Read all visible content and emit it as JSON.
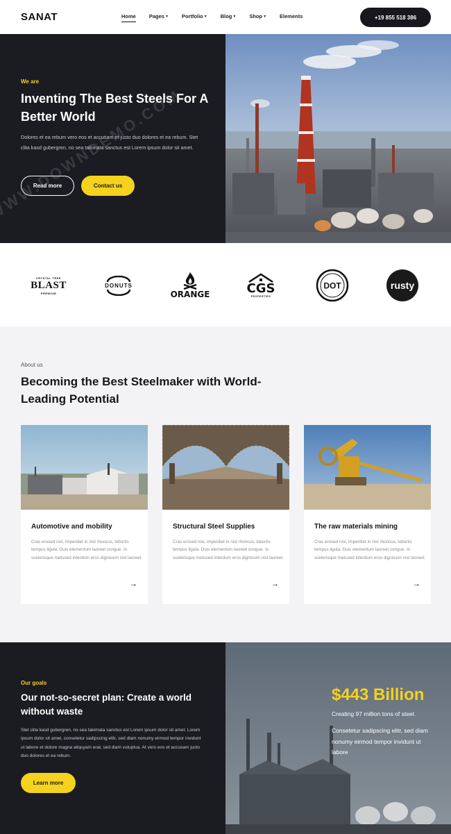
{
  "header": {
    "logo": "SANAT",
    "nav": [
      {
        "label": "Home",
        "has_caret": false,
        "active": true
      },
      {
        "label": "Pages",
        "has_caret": true
      },
      {
        "label": "Portfolio",
        "has_caret": true
      },
      {
        "label": "Blog",
        "has_caret": true
      },
      {
        "label": "Shop",
        "has_caret": true
      },
      {
        "label": "Elements",
        "has_caret": false
      }
    ],
    "phone": "+19 855 518 386"
  },
  "hero": {
    "kicker": "We are",
    "title": "Inventing The Best Steels For A Better World",
    "text": "Dolores et ea rebum vero eos et accusam et justo duo dolores et ea rebum. Stet clita kasd gubergren, no sea takimata sanctus est Lorem ipsum dolor sit amet.",
    "btn_read_more": "Read more",
    "btn_contact": "Contact us"
  },
  "brands": {
    "blast": {
      "top": "CRYSTAL TREE",
      "name": "BLAST",
      "bottom": "PREMIUM"
    },
    "donuts": {
      "name": "DONUTS"
    },
    "orange": {
      "name": "ORANGE"
    },
    "cgs": {
      "name": "CGS",
      "bottom": "PROPERTIES"
    },
    "dot": {
      "name": "DOT"
    },
    "rusty": {
      "name": "rusty"
    }
  },
  "about": {
    "kicker": "About us",
    "title": "Becoming the Best Steelmaker with World-Leading Potential",
    "cards": [
      {
        "title": "Automotive and mobility",
        "text": "Cras erosed nisl, imperdiet in nisl rhoncus, lobortis tempus ligula. Duis elementum laoreet congue. In scelerisque metused interdum eros dignissim nisl laoreet."
      },
      {
        "title": "Structural Steel Supplies",
        "text": "Cras erosed nisl, imperdiet in nisl rhoncus, lobortis tempus ligula. Duis elementum laoreet congue. In scelerisque metused interdum eros dignissim nisl laoreet."
      },
      {
        "title": "The raw materials mining",
        "text": "Cras erosed nisl, imperdiet in nisl rhoncus, lobortis tempus ligula. Duis elementum laoreet congue. In scelerisque metused interdum eros dignissim nisl laoreet."
      }
    ],
    "arrow_icon": "arrow-right-icon"
  },
  "goals": {
    "kicker": "Our goals",
    "title": "Our not-so-secret plan: Create a world without waste",
    "text": "Stet clita kasd gubergren, no sea takimata sanctus est Lorem ipsum dolor sit amet. Lorem ipsum dolor sit amet, consetetur sadipscing elitr, sed diam nonumy eirmod tempor invidunt ut labore et dolore magna aliquyam erat, sed diam voluptua. At vero eos et accusam justo duo dolores et ea rebum.",
    "btn_learn": "Learn more",
    "stat_value": "$443 Billion",
    "stat_sub": "Creating 97 million tons of steel.",
    "stat_text": "Consetetur sadipscing elitr, sed diam nonumy eirmod tempor invidunt ut labore"
  },
  "watermark": "WWW.DOWNDEMO.COM",
  "colors": {
    "accent_yellow": "#f5d21e",
    "dark_bg": "#1b1b22",
    "light_bg": "#f3f3f5"
  }
}
